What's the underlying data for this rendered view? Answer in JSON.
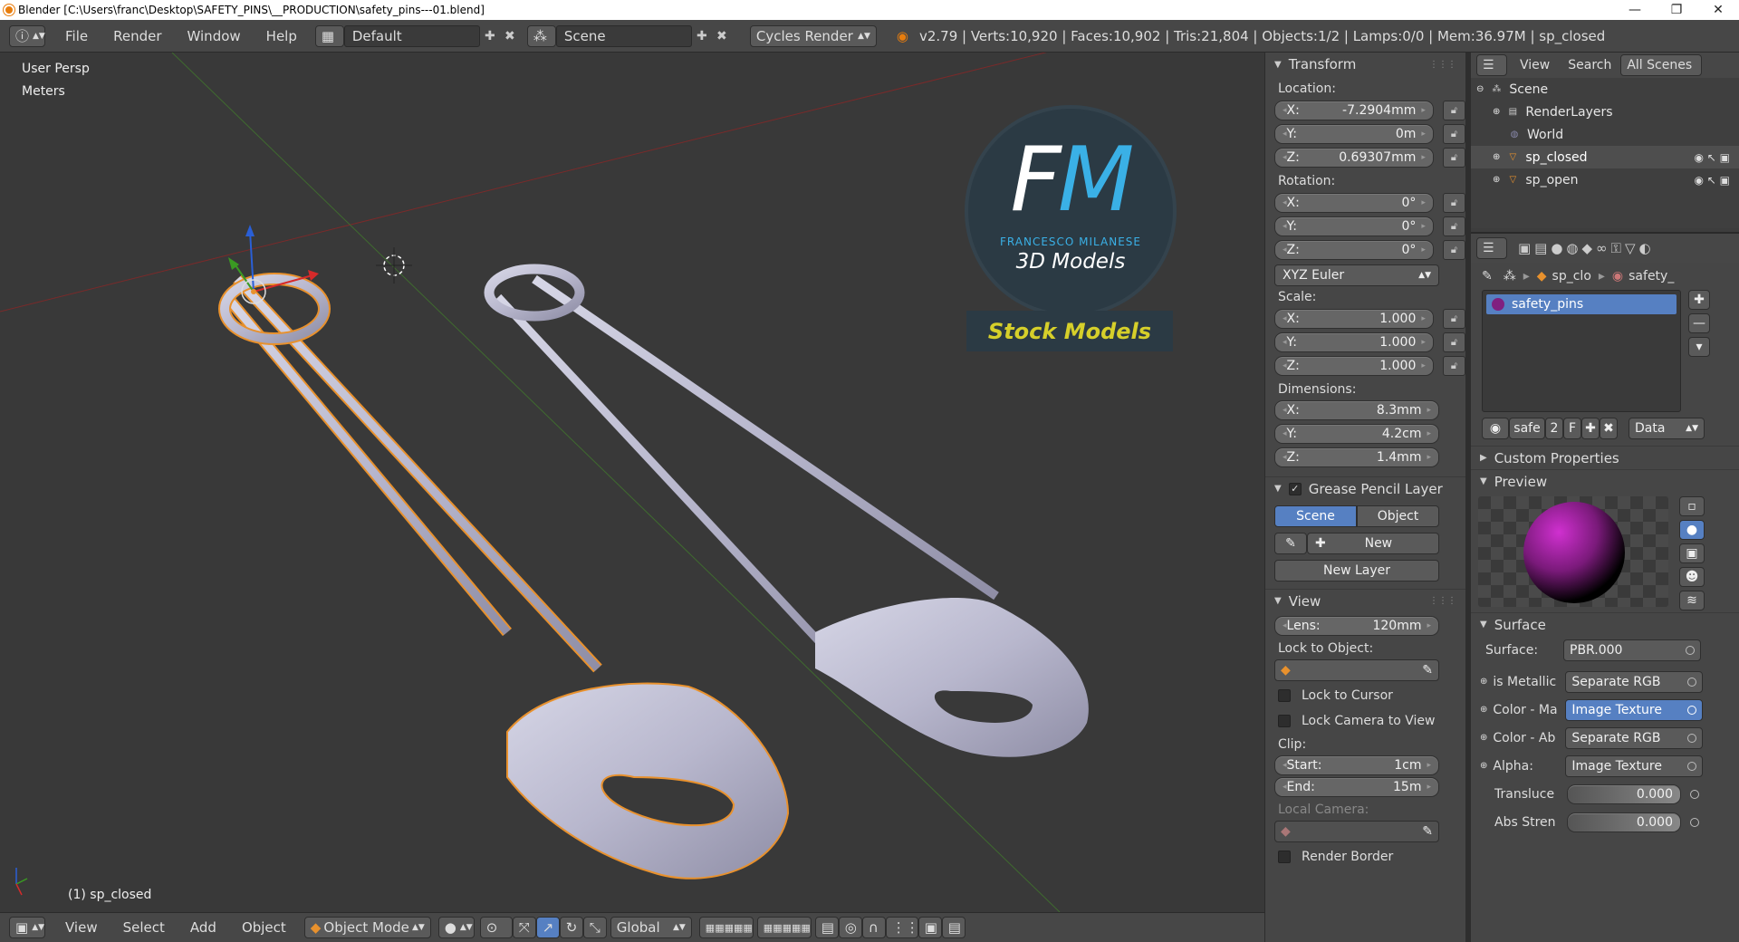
{
  "window": {
    "title": "Blender  [C:\\Users\\franc\\Desktop\\SAFETY_PINS\\__PRODUCTION\\safety_pins---01.blend]",
    "minimize": "—",
    "maximize": "❐",
    "close": "✕"
  },
  "topbar": {
    "menus": [
      "File",
      "Render",
      "Window",
      "Help"
    ],
    "layout": "Default",
    "scene": "Scene",
    "engine": "Cycles Render",
    "stats": "v2.79 | Verts:10,920 | Faces:10,902 | Tris:21,804 | Objects:1/2 | Lamps:0/0 | Mem:36.97M | sp_closed"
  },
  "viewport": {
    "view_name": "User Persp",
    "units": "Meters",
    "selected": "(1) sp_closed",
    "logo": {
      "letters": "FM",
      "author": "FRANCESCO MILANESE",
      "tagline": "3D Models",
      "banner": "Stock Models"
    }
  },
  "viewbar": {
    "menus": [
      "View",
      "Select",
      "Add",
      "Object"
    ],
    "mode": "Object Mode",
    "orientation": "Global"
  },
  "npanel": {
    "transform_header": "Transform",
    "location_label": "Location:",
    "location": [
      {
        "axis": "X:",
        "value": "-7.2904mm"
      },
      {
        "axis": "Y:",
        "value": "0m"
      },
      {
        "axis": "Z:",
        "value": "0.69307mm"
      }
    ],
    "rotation_label": "Rotation:",
    "rotation": [
      {
        "axis": "X:",
        "value": "0°"
      },
      {
        "axis": "Y:",
        "value": "0°"
      },
      {
        "axis": "Z:",
        "value": "0°"
      }
    ],
    "rotation_mode": "XYZ Euler",
    "scale_label": "Scale:",
    "scale": [
      {
        "axis": "X:",
        "value": "1.000"
      },
      {
        "axis": "Y:",
        "value": "1.000"
      },
      {
        "axis": "Z:",
        "value": "1.000"
      }
    ],
    "dimensions_label": "Dimensions:",
    "dimensions": [
      {
        "axis": "X:",
        "value": "8.3mm"
      },
      {
        "axis": "Y:",
        "value": "4.2cm"
      },
      {
        "axis": "Z:",
        "value": "1.4mm"
      }
    ],
    "gp_header": "Grease Pencil Layer",
    "gp_tabs": [
      "Scene",
      "Object"
    ],
    "gp_new": "New",
    "gp_new_layer": "New Layer",
    "view_header": "View",
    "lens_label": "Lens:",
    "lens": "120mm",
    "lock_object_label": "Lock to Object:",
    "lock_cursor": "Lock to Cursor",
    "lock_camera": "Lock Camera to View",
    "clip_label": "Clip:",
    "clip_start_label": "Start:",
    "clip_start": "1cm",
    "clip_end_label": "End:",
    "clip_end": "15m",
    "local_camera": "Local Camera:",
    "render_border": "Render Border"
  },
  "outliner": {
    "menus": [
      "View",
      "Search"
    ],
    "filter": "All Scenes",
    "items": [
      {
        "label": "Scene",
        "icon": "scene-icon"
      },
      {
        "label": "RenderLayers",
        "icon": "renderlayers-icon"
      },
      {
        "label": "World",
        "icon": "world-icon"
      },
      {
        "label": "sp_closed",
        "icon": "mesh-object-icon"
      },
      {
        "label": "sp_open",
        "icon": "mesh-object-icon"
      }
    ]
  },
  "properties": {
    "breadcrumb_object": "sp_clo",
    "breadcrumb_material": "safety_",
    "slot_name": "safety_pins",
    "mat_name": "safe",
    "users": "2",
    "fake": "F",
    "link": "Data",
    "custom_properties": "Custom Properties",
    "preview": "Preview",
    "surface_header": "Surface",
    "surface_label": "Surface:",
    "surface_value": "PBR.000",
    "inputs": [
      {
        "label": "is Metallic",
        "value": "Separate RGB"
      },
      {
        "label": "Color - Ma",
        "value": "Image Texture"
      },
      {
        "label": "Color - Ab",
        "value": "Separate RGB"
      },
      {
        "label": "Alpha:",
        "value": "Image Texture"
      }
    ],
    "sliders": [
      {
        "label": "Transluce",
        "value": "0.000"
      },
      {
        "label": "Abs Stren",
        "value": "0.000"
      }
    ]
  },
  "colors": {
    "accent": "#5680c2",
    "selection_outline": "#e8912d",
    "banner_text": "#d6cf2a",
    "logo_bg": "#2b3a44"
  }
}
